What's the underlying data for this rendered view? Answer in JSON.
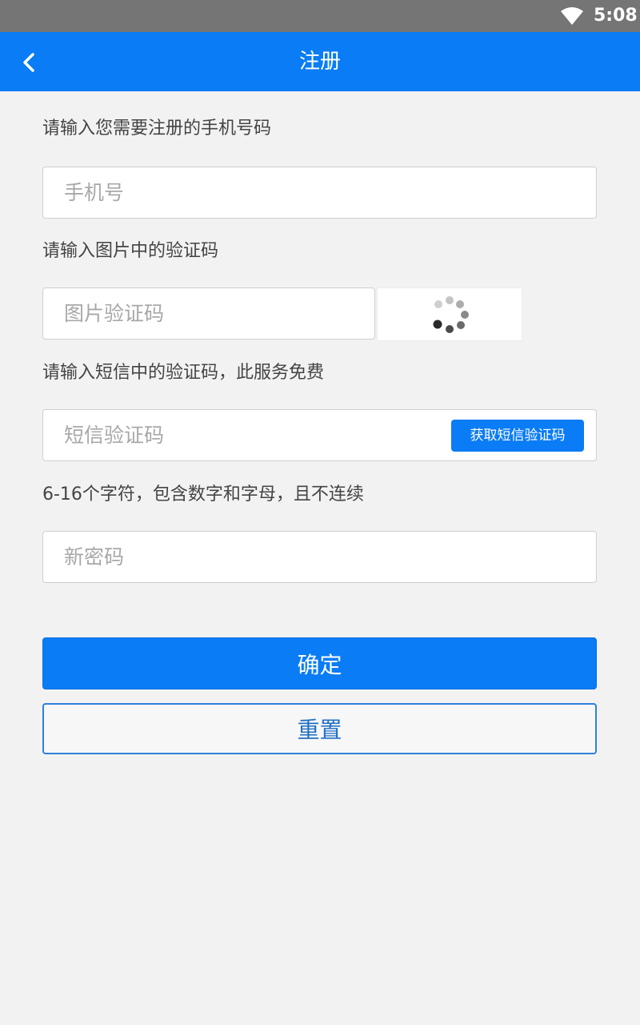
{
  "status_bar": {
    "time": "5:08",
    "icons": [
      "wifi-icon"
    ]
  },
  "header": {
    "title": "注册",
    "back_icon": "chevron-left-icon"
  },
  "form": {
    "phone": {
      "label": "请输入您需要注册的手机号码",
      "placeholder": "手机号",
      "value": ""
    },
    "captcha": {
      "label": "请输入图片中的验证码",
      "placeholder": "图片验证码",
      "value": "",
      "image_icon": "loading-spinner-icon"
    },
    "sms": {
      "label": "请输入短信中的验证码，此服务免费",
      "placeholder": "短信验证码",
      "value": "",
      "button_label": "获取短信验证码"
    },
    "password": {
      "label": "6-16个字符，包含数字和字母，且不连续",
      "placeholder": "新密码",
      "value": ""
    }
  },
  "actions": {
    "confirm_label": "确定",
    "reset_label": "重置"
  },
  "colors": {
    "primary": "#0a7cf5",
    "status_bar": "#757575",
    "background": "#f2f2f2",
    "reset_border": "#2b82d9"
  }
}
